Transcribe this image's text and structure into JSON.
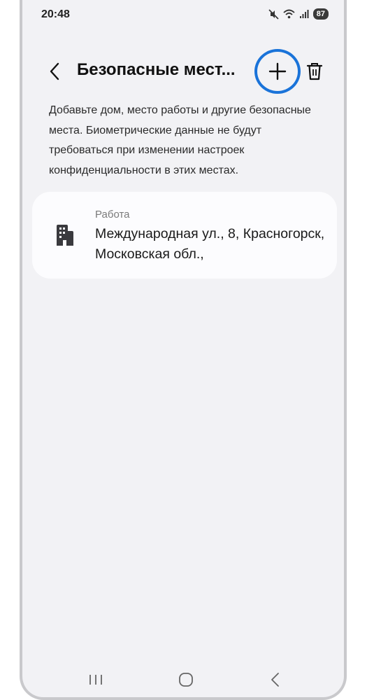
{
  "status_bar": {
    "time": "20:48",
    "battery": "87",
    "icons": [
      "mute-icon",
      "wifi-icon",
      "signal-icon",
      "battery-icon"
    ]
  },
  "header": {
    "title": "Безопасные мест...",
    "back_icon": "chevron-left-icon",
    "add_icon": "plus-icon",
    "delete_icon": "trash-icon"
  },
  "description": "Добавьте дом, место работы и другие безопасные места. Биометрические данные не будут требоваться при изменении настроек конфиденциальности в этих местах.",
  "places": [
    {
      "label": "Работа",
      "address": "Международная ул., 8, Красногорск, Московская обл.,",
      "icon": "building-icon"
    }
  ],
  "nav_bar": {
    "icons": [
      "recent-apps-icon",
      "home-icon",
      "back-icon"
    ]
  },
  "colors": {
    "background": "#f2f2f5",
    "card": "#fcfcfe",
    "highlight": "#1a73d9"
  }
}
